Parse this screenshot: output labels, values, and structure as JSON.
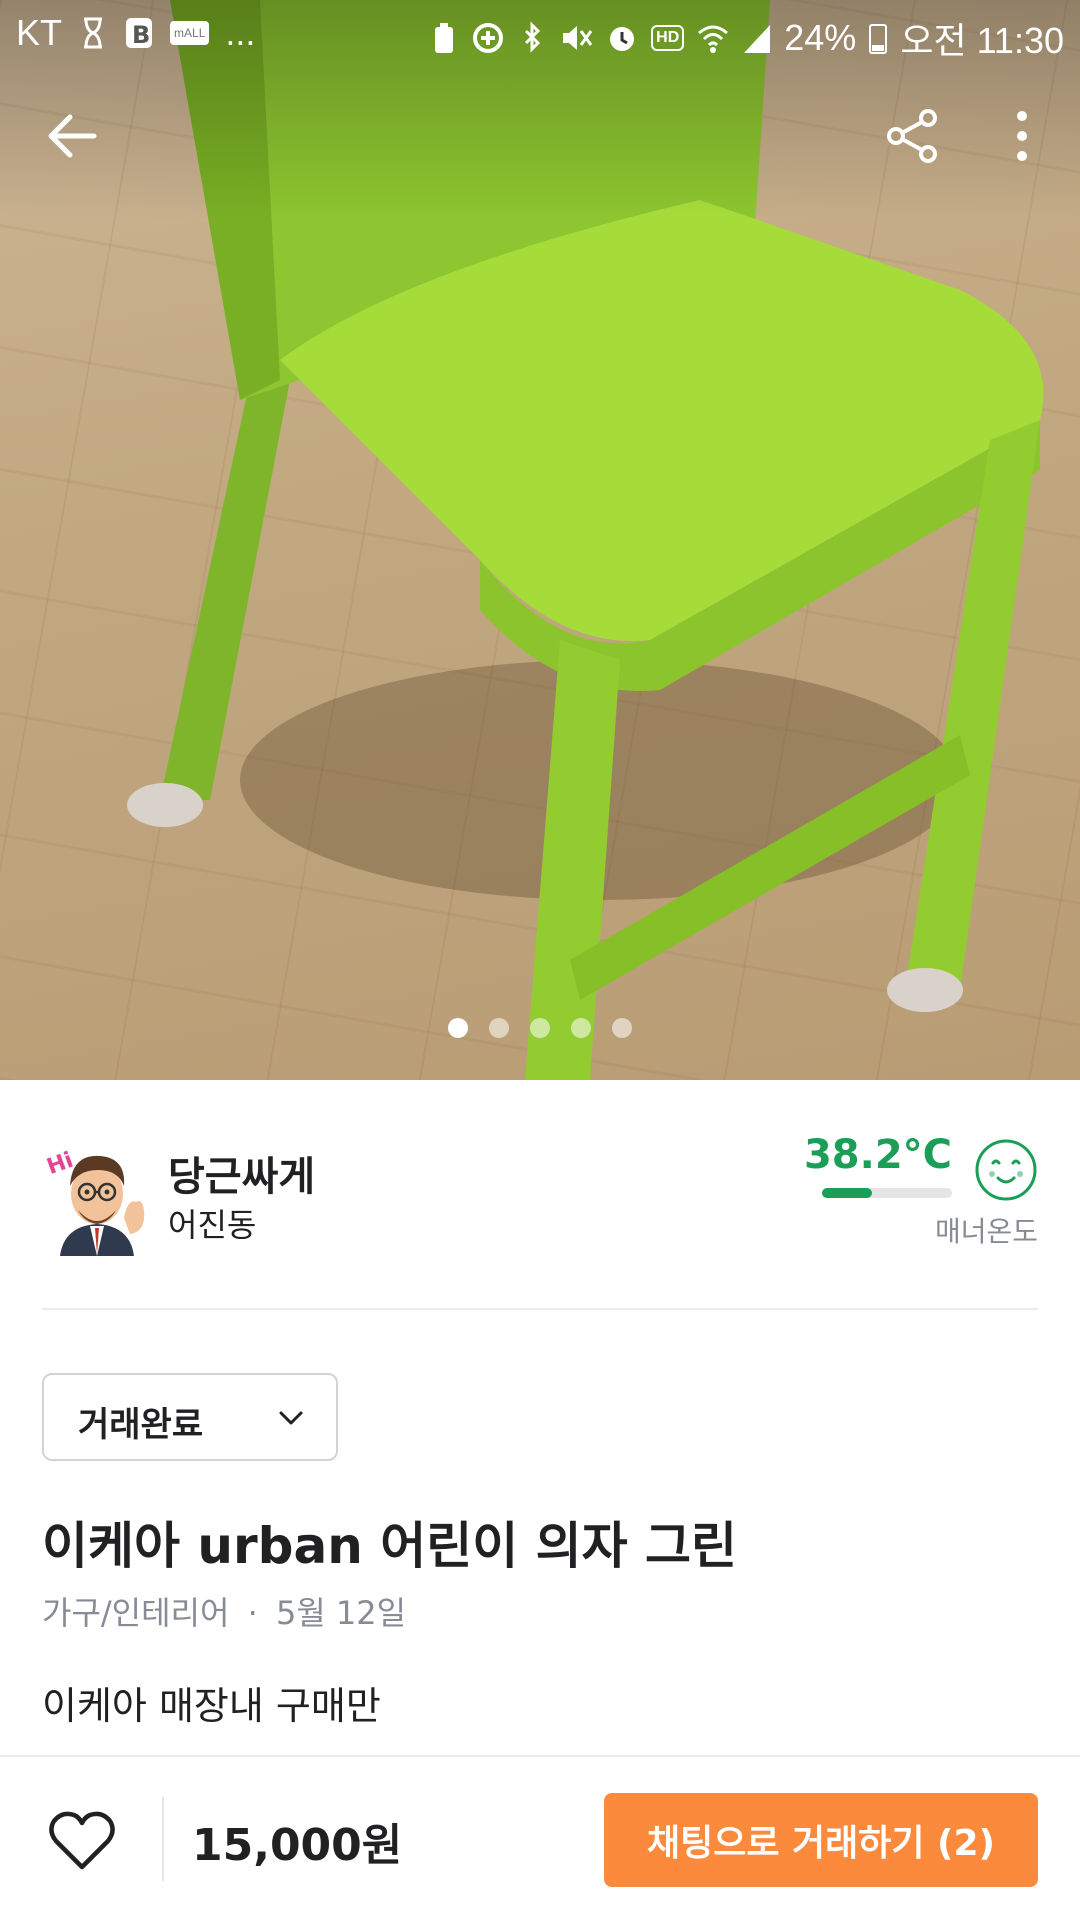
{
  "status_bar": {
    "carrier": "KT",
    "mall_badge": "mALL",
    "more": "...",
    "hd_badge": "HD",
    "battery": "24%",
    "time": "오전 11:30"
  },
  "toolbar": {
    "back_icon": "arrow-left-icon",
    "share_icon": "share-icon",
    "more_icon": "more-vertical-icon"
  },
  "carousel": {
    "image_count": 5,
    "active_index": 0
  },
  "seller": {
    "nickname": "당근싸게",
    "location": "어진동",
    "manner_temp": "38.2°C",
    "manner_temp_value": 38.2,
    "manner_label": "매너온도",
    "avatar_tag": "Hi",
    "accent_color": "#1a9e58"
  },
  "status_select": {
    "value": "거래완료"
  },
  "post": {
    "title": "이케아 urban 어린이 의자 그린",
    "category": "가구/인테리어",
    "date": "5월 12일",
    "separator": "·",
    "description_line1": "이케아 매장내 구매만"
  },
  "bottom": {
    "price": "15,000원",
    "chat_button": "채팅으로 거래하기 (2)",
    "chat_button_color": "#fb8a3c"
  }
}
